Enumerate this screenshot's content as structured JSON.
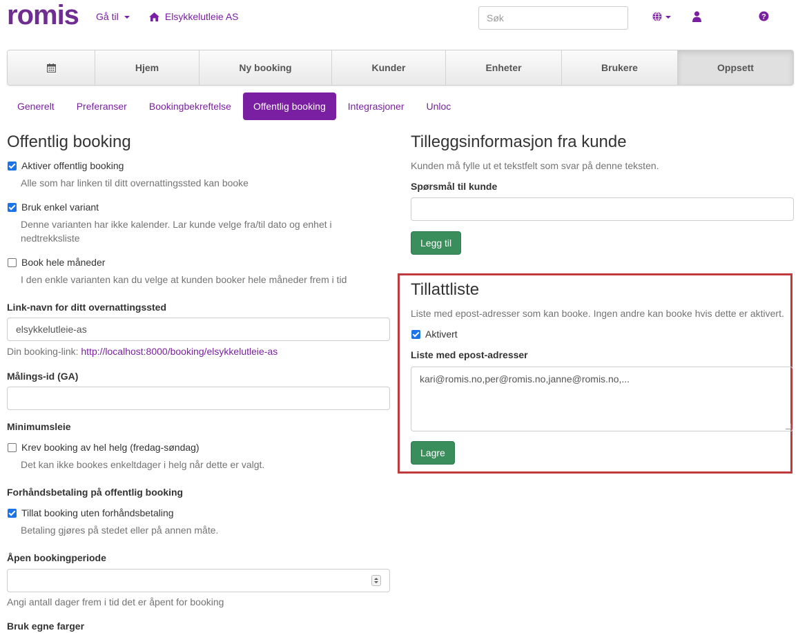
{
  "navbar": {
    "logo": "romis",
    "goto_label": "Gå til",
    "company_label": "Elsykkelutleie AS",
    "search_placeholder": "Søk",
    "icons": [
      "globe-icon",
      "user-icon",
      "help-icon"
    ]
  },
  "main_tabs": [
    {
      "label": "",
      "icon": "calendar-icon"
    },
    {
      "label": "Hjem"
    },
    {
      "label": "Ny booking"
    },
    {
      "label": "Kunder"
    },
    {
      "label": "Enheter"
    },
    {
      "label": "Brukere"
    },
    {
      "label": "Oppsett",
      "active": true
    }
  ],
  "sub_tabs": [
    {
      "label": "Generelt"
    },
    {
      "label": "Preferanser"
    },
    {
      "label": "Bookingbekreftelse"
    },
    {
      "label": "Offentlig booking",
      "active": true
    },
    {
      "label": "Integrasjoner"
    },
    {
      "label": "Unloc"
    }
  ],
  "left": {
    "title": "Offentlig booking",
    "public_booking": {
      "label": "Aktiver offentlig booking",
      "checked": true,
      "help": "Alle som har linken til ditt overnattingssted kan booke"
    },
    "simple_variant": {
      "label": "Bruk enkel variant",
      "checked": true,
      "help_line1": "Denne varianten har ikke kalender. Lar kunde velge fra/til dato og enhet i",
      "help_line2": "nedtrekksliste"
    },
    "whole_months": {
      "label": "Book hele måneder",
      "checked": false,
      "help": "I den enkle varianten kan du velge at kunden booker hele måneder frem i tid"
    },
    "link_name": {
      "label": "Link-navn for ditt overnattingssted",
      "value": "elsykkelutleie-as",
      "help_prefix": "Din booking-link:",
      "link": "http://localhost:8000/booking/elsykkelutleie-as"
    },
    "ga_id": {
      "label": "Målings-id (GA)",
      "value": ""
    },
    "min_rent": {
      "label": "Minimumsleie",
      "checkbox": "Krev booking av hel helg (fredag-søndag)",
      "checked": false,
      "help": "Det kan ikke bookes enkeltdager i helg når dette er valgt."
    },
    "prepay": {
      "label": "Forhåndsbetaling på offentlig booking",
      "checkbox": "Tillat booking uten forhåndsbetaling",
      "checked": true,
      "help": "Betaling gjøres på stedet eller på annen måte."
    },
    "open_period": {
      "label": "Åpen bookingperiode",
      "value": "",
      "help": "Angi antall dager frem i tid det er åpent for booking"
    },
    "own_colors": {
      "label": "Bruk egne farger"
    }
  },
  "right": {
    "extra_info": {
      "title": "Tilleggsinformasjon fra kunde",
      "help": "Kunden må fylle ut et tekstfelt som svar på denne teksten.",
      "question_label": "Spørsmål til kunde",
      "question_value": "",
      "add_button": "Legg til"
    },
    "allowlist": {
      "title": "Tillattliste",
      "help": "Liste med epost-adresser som kan booke. Ingen andre kan booke hvis dette er aktivert.",
      "enabled_label": "Aktivert",
      "enabled": true,
      "emails_label": "Liste med epost-adresser",
      "emails_value": "kari@romis.no,per@romis.no,janne@romis.no,...",
      "save_button": "Lagre"
    }
  },
  "colors": {
    "brand": "#7b1fa2",
    "success": "#3a8e5c",
    "highlight": "#c0393b"
  }
}
